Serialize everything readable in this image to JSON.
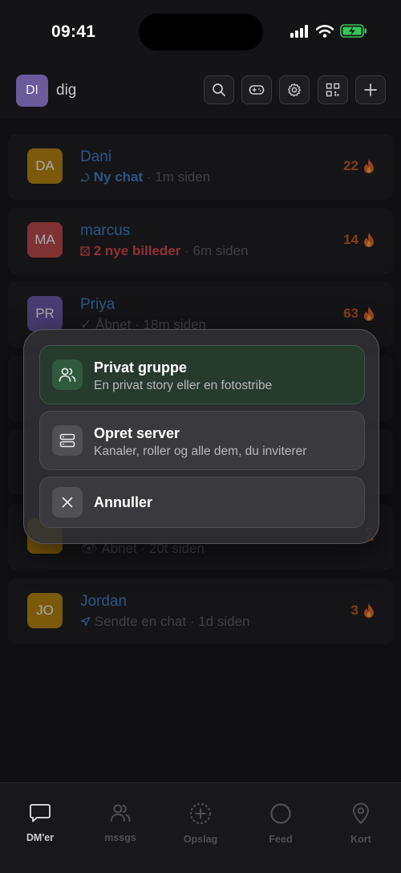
{
  "status": {
    "time": "09:41"
  },
  "header": {
    "avatar_initials": "DI",
    "username": "dig"
  },
  "chats": [
    {
      "initials": "DA",
      "name": "Dani",
      "action": "Ny chat",
      "time": "· 1m siden",
      "streak": "22",
      "avatar_color": "#b8860b",
      "action_color": "#3f7fc4"
    },
    {
      "initials": "MA",
      "name": "marcus",
      "action": "2 nye billeder",
      "time": "· 6m siden",
      "streak": "14",
      "avatar_color": "#c0474b",
      "action_color": "#d9454a"
    },
    {
      "initials": "PR",
      "name": "Priya",
      "action": "Åbnet",
      "time": "· 18m siden",
      "streak": "63",
      "avatar_color": "#6a5aa8",
      "action_color": "#5e5e64"
    },
    {
      "action": "Åbnet",
      "time": "· 20t siden"
    },
    {
      "initials": "JO",
      "name": "Jordan",
      "action": "Sendte en chat",
      "time": "· 1d siden",
      "streak": "3",
      "avatar_color": "#b8860b",
      "action_color": "#5e5e64"
    }
  ],
  "sheet": {
    "options": [
      {
        "title": "Privat gruppe",
        "desc": "En privat story eller en fotostribe",
        "icon": "people-icon"
      },
      {
        "title": "Opret server",
        "desc": "Kanaler, roller og alle dem, du inviterer",
        "icon": "server-icon"
      },
      {
        "title": "Annuller",
        "icon": "close-icon"
      }
    ]
  },
  "tabs": [
    {
      "label": "DM'er",
      "icon": "chat-bubble-icon",
      "active": true
    },
    {
      "label": "mssgs",
      "icon": "users-icon"
    },
    {
      "label": "Opslag",
      "icon": "plus-circle-icon"
    },
    {
      "label": "Feed",
      "icon": "circle-icon"
    },
    {
      "label": "Kort",
      "icon": "map-pin-icon"
    }
  ],
  "colors": {
    "accent_blue": "#3f7fc4",
    "streak_orange": "#c8571f",
    "battery_green": "#34c759"
  }
}
